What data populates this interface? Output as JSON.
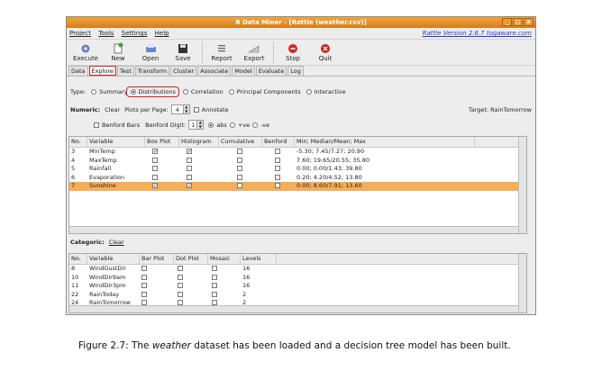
{
  "window": {
    "title": "R Data Miner - [Rattle (weather.csv)]",
    "controls": [
      "_",
      "□",
      "x"
    ]
  },
  "menu": {
    "items": [
      "Project",
      "Tools",
      "Settings",
      "Help"
    ],
    "version": "Rattle Version 2.6.7 togaware.com"
  },
  "toolbar": {
    "buttons": [
      {
        "label": "Execute",
        "icon": "execute-gear-icon"
      },
      {
        "label": "New",
        "icon": "new-document-icon"
      },
      {
        "label": "Open",
        "icon": "open-printer-icon"
      },
      {
        "label": "Save",
        "icon": "save-floppy-icon"
      },
      {
        "label": "Report",
        "icon": "report-list-icon"
      },
      {
        "label": "Export",
        "icon": "export-icon"
      },
      {
        "label": "Stop",
        "icon": "stop-icon"
      },
      {
        "label": "Quit",
        "icon": "quit-icon"
      }
    ]
  },
  "tabs": [
    "Data",
    "Explore",
    "Test",
    "Transform",
    "Cluster",
    "Associate",
    "Model",
    "Evaluate",
    "Log"
  ],
  "active_tab": "Explore",
  "type_row": {
    "label": "Type:",
    "options": [
      "Summary",
      "Distributions",
      "Correlation",
      "Principal Components",
      "Interactive"
    ],
    "selected": "Distributions"
  },
  "numeric_row": {
    "label": "Numeric:",
    "clear": "Clear",
    "plots_label": "Plots per Page:",
    "plots_value": "4",
    "annotate": "Annotate",
    "target": "Target: RainTomorrow"
  },
  "benford_row": {
    "benford_bars": "Benford Bars",
    "digit_label": "Benford Digit:",
    "digit_value": "1",
    "abs": "abs",
    "pos": "+ve",
    "neg": "-ve"
  },
  "numeric_table": {
    "headers": [
      "No.",
      "Variable",
      "Box Plot",
      "Histogram",
      "Cumulative",
      "Benford",
      "Min; Median/Mean; Max"
    ],
    "rows": [
      {
        "no": "3",
        "var": "MinTemp",
        "box": "✓",
        "hist": "✓",
        "cum": "",
        "ben": "",
        "stats": "-5.30; 7.45/7.27; 20.90"
      },
      {
        "no": "4",
        "var": "MaxTemp",
        "box": "",
        "hist": "",
        "cum": "",
        "ben": "",
        "stats": "7.60; 19.65/20.55; 35.80"
      },
      {
        "no": "5",
        "var": "Rainfall",
        "box": "",
        "hist": "",
        "cum": "",
        "ben": "",
        "stats": "0.00; 0.00/1.43; 39.80"
      },
      {
        "no": "6",
        "var": "Evaporation",
        "box": "",
        "hist": "",
        "cum": "",
        "ben": "",
        "stats": "0.20; 4.20/4.52; 13.80"
      },
      {
        "no": "7",
        "var": "Sunshine",
        "box": "✓",
        "hist": "✓",
        "cum": "",
        "ben": "",
        "stats": "0.00; 8.60/7.91; 13.60"
      }
    ]
  },
  "categoric_row": {
    "label": "Categoric:",
    "clear": "Clear"
  },
  "categoric_table": {
    "headers": [
      "No.",
      "Variable",
      "Bar Plot",
      "Dot Plot",
      "Mosaic",
      "Levels"
    ],
    "rows": [
      {
        "no": "8",
        "var": "WindGustDir",
        "levels": "16"
      },
      {
        "no": "10",
        "var": "WindDir9am",
        "levels": "16"
      },
      {
        "no": "11",
        "var": "WindDir3pm",
        "levels": "16"
      },
      {
        "no": "22",
        "var": "RainToday",
        "levels": "2"
      },
      {
        "no": "24",
        "var": "RainTomorrow",
        "levels": "2"
      }
    ]
  },
  "caption": {
    "prefix": "Figure 2.7: The ",
    "emph": "weather",
    "suffix": " dataset has been loaded and a decision tree model has been built."
  }
}
